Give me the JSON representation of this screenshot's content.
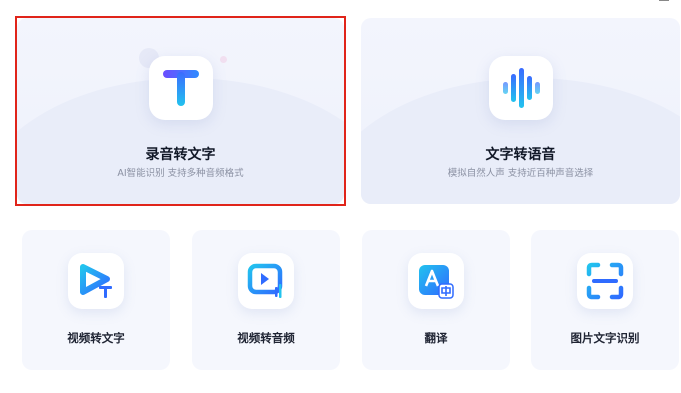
{
  "features": {
    "record_to_text": {
      "title": "录音转文字",
      "subtitle": "AI智能识别 支持多种音频格式",
      "selected": true,
      "icon": "text-t-icon"
    },
    "text_to_speech": {
      "title": "文字转语音",
      "subtitle": "模拟自然人声 支持近百种声音选择",
      "icon": "sound-wave-icon"
    },
    "video_to_text": {
      "title": "视频转文字",
      "icon": "video-text-icon"
    },
    "video_to_audio": {
      "title": "视频转音频",
      "icon": "video-audio-icon"
    },
    "translate": {
      "title": "翻译",
      "icon": "translate-icon"
    },
    "image_ocr": {
      "title": "图片文字识别",
      "icon": "scan-text-icon"
    }
  },
  "colors": {
    "accent_blue": "#2f6bff",
    "accent_cyan": "#22c3ee",
    "selection_border": "#e0241a",
    "card_bg": "#f5f7fd"
  }
}
